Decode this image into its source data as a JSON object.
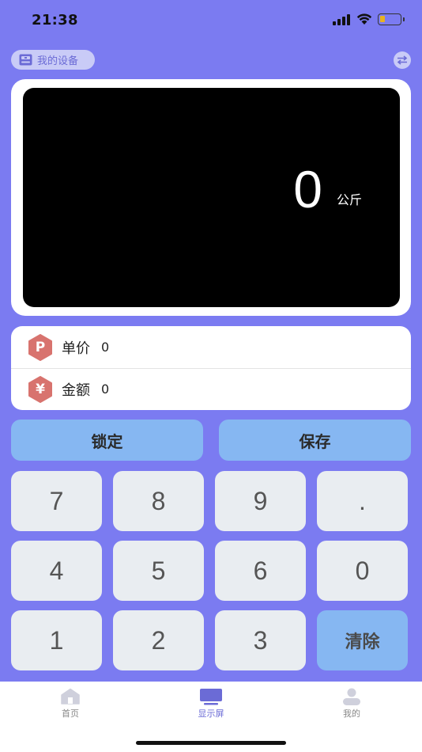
{
  "status_bar": {
    "time": "21:38"
  },
  "header": {
    "device_label": "我的设备"
  },
  "display": {
    "weight": "0",
    "unit": "公斤"
  },
  "info": {
    "unit_price": {
      "badge": "P",
      "label": "单价",
      "value": "0"
    },
    "amount": {
      "badge": "¥",
      "label": "金额",
      "value": "0"
    }
  },
  "actions": {
    "lock": "锁定",
    "save": "保存"
  },
  "keypad": {
    "keys": [
      "7",
      "8",
      "9",
      ".",
      "4",
      "5",
      "6",
      "0",
      "1",
      "2",
      "3",
      "清除"
    ]
  },
  "tabs": [
    {
      "label": "首页",
      "icon": "home-icon"
    },
    {
      "label": "显示屏",
      "icon": "monitor-icon"
    },
    {
      "label": "我的",
      "icon": "person-icon"
    }
  ],
  "colors": {
    "background": "#7b7bf1",
    "accent_button": "#86b7f2",
    "key": "#e9edf1",
    "badge": "#d8736e",
    "active_tab": "#6b6bd6"
  }
}
